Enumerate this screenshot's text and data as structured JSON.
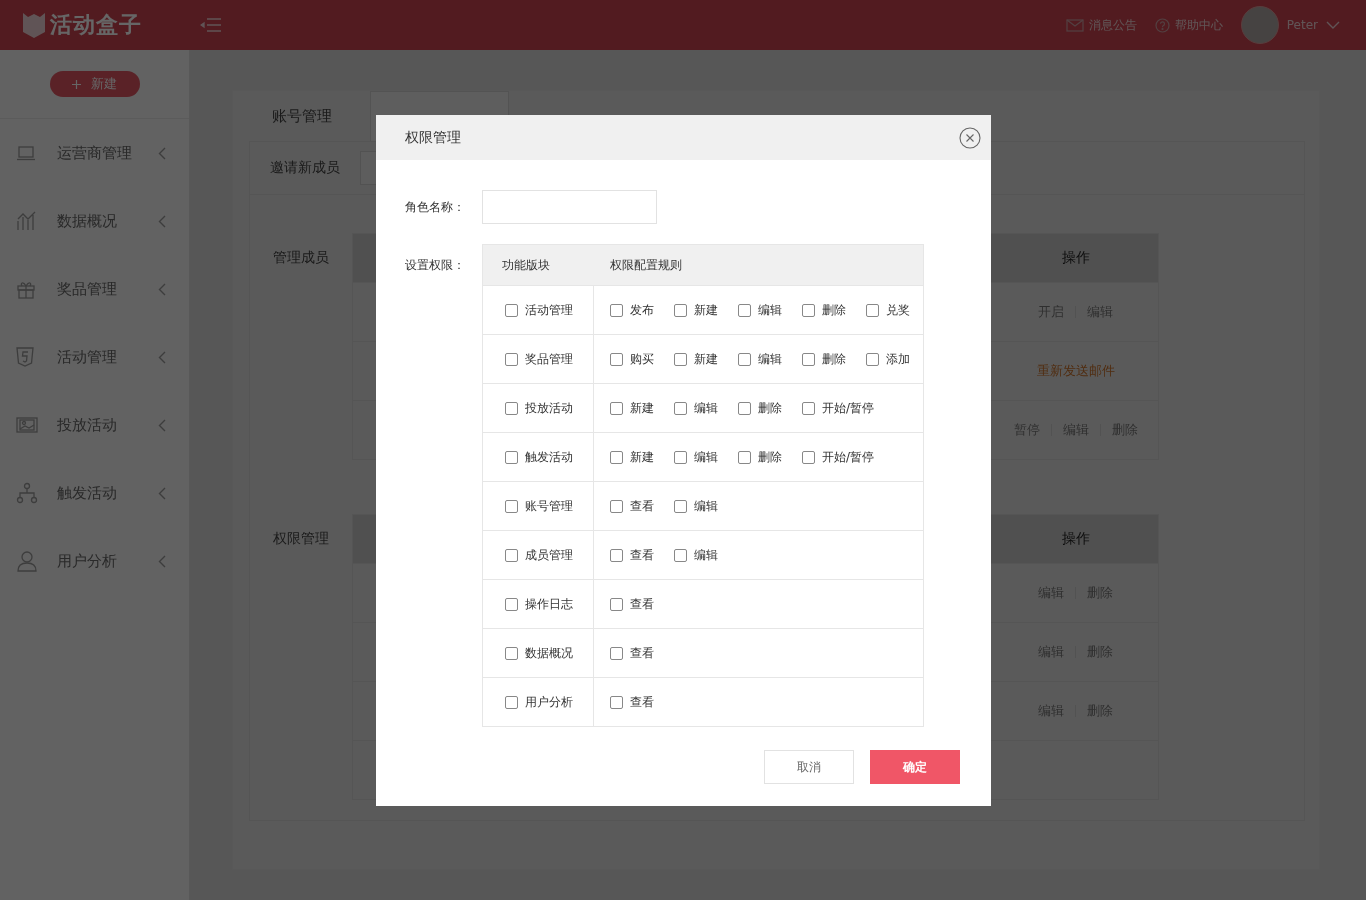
{
  "header": {
    "logo_text": "活动盒子",
    "links": [
      {
        "kind": "mail",
        "label": "消息公告"
      },
      {
        "kind": "help",
        "label": "帮助中心"
      }
    ],
    "user_name": "Peter"
  },
  "sidebar": {
    "new_button": "新建",
    "items": [
      {
        "label": "运营商管理"
      },
      {
        "label": "数据概况"
      },
      {
        "label": "奖品管理"
      },
      {
        "label": "活动管理"
      },
      {
        "label": "投放活动"
      },
      {
        "label": "触发活动"
      },
      {
        "label": "用户分析"
      }
    ]
  },
  "page_tabs": [
    {
      "label": "账号管理",
      "selected": false
    }
  ],
  "invite": {
    "label": "邀请新成员"
  },
  "sections": [
    {
      "label": "管理成员",
      "action_header": "操作",
      "rows": [
        {
          "actions": [
            {
              "label": "开启",
              "kind": "normal"
            },
            {
              "label": "编辑",
              "kind": "normal"
            }
          ]
        },
        {
          "actions": [
            {
              "label": "重新发送邮件",
              "kind": "highlight"
            }
          ]
        },
        {
          "actions": [
            {
              "label": "暂停",
              "kind": "normal"
            },
            {
              "label": "编辑",
              "kind": "normal"
            },
            {
              "label": "删除",
              "kind": "normal"
            }
          ]
        }
      ]
    },
    {
      "label": "权限管理",
      "action_header": "操作",
      "rows": [
        {
          "actions": [
            {
              "label": "编辑",
              "kind": "normal"
            },
            {
              "label": "删除",
              "kind": "normal"
            }
          ]
        },
        {
          "actions": [
            {
              "label": "编辑",
              "kind": "normal"
            },
            {
              "label": "删除",
              "kind": "normal"
            }
          ]
        },
        {
          "actions": [
            {
              "label": "编辑",
              "kind": "normal"
            },
            {
              "label": "删除",
              "kind": "normal"
            }
          ]
        },
        {
          "actions": []
        }
      ]
    }
  ],
  "dialog": {
    "title": "权限管理",
    "role_label": "角色名称：",
    "permission_label": "设置权限：",
    "columns": [
      "功能版块",
      "权限配置规则"
    ],
    "modules": [
      {
        "name": "活动管理",
        "checked": false,
        "rules": [
          {
            "label": "发布",
            "checked": false
          },
          {
            "label": "新建",
            "checked": false
          },
          {
            "label": "编辑",
            "checked": false
          },
          {
            "label": "删除",
            "checked": false
          },
          {
            "label": "兑奖",
            "checked": false
          }
        ]
      },
      {
        "name": "奖品管理",
        "checked": false,
        "rules": [
          {
            "label": "购买",
            "checked": false
          },
          {
            "label": "新建",
            "checked": false
          },
          {
            "label": "编辑",
            "checked": false
          },
          {
            "label": "删除",
            "checked": false
          },
          {
            "label": "添加",
            "checked": false
          }
        ]
      },
      {
        "name": "投放活动",
        "checked": false,
        "rules": [
          {
            "label": "新建",
            "checked": false
          },
          {
            "label": "编辑",
            "checked": false
          },
          {
            "label": "删除",
            "checked": false
          },
          {
            "label": "开始/暂停",
            "checked": false
          }
        ]
      },
      {
        "name": "触发活动",
        "checked": false,
        "rules": [
          {
            "label": "新建",
            "checked": false
          },
          {
            "label": "编辑",
            "checked": false
          },
          {
            "label": "删除",
            "checked": false
          },
          {
            "label": "开始/暂停",
            "checked": false
          }
        ]
      },
      {
        "name": "账号管理",
        "checked": false,
        "rules": [
          {
            "label": "查看",
            "checked": false
          },
          {
            "label": "编辑",
            "checked": false
          }
        ]
      },
      {
        "name": "成员管理",
        "checked": false,
        "rules": [
          {
            "label": "查看",
            "checked": false
          },
          {
            "label": "编辑",
            "checked": false
          }
        ]
      },
      {
        "name": "操作日志",
        "checked": false,
        "rules": [
          {
            "label": "查看",
            "checked": false
          }
        ]
      },
      {
        "name": "数据概况",
        "checked": false,
        "rules": [
          {
            "label": "查看",
            "checked": false
          }
        ]
      },
      {
        "name": "用户分析",
        "checked": false,
        "rules": [
          {
            "label": "查看",
            "checked": false
          }
        ]
      }
    ],
    "buttons": [
      {
        "label": "取消",
        "kind": "secondary"
      },
      {
        "label": "确定",
        "kind": "primary"
      }
    ]
  }
}
